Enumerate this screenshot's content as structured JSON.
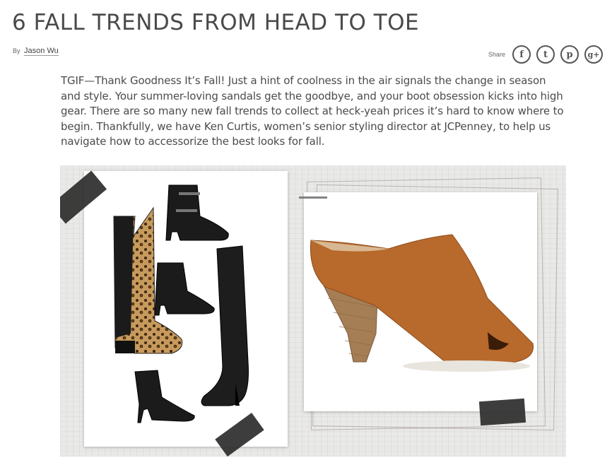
{
  "article": {
    "title": "6 FALL TRENDS FROM HEAD TO TOE",
    "byline_prefix": "By",
    "author": "Jason Wu",
    "intro": "TGIF—Thank Goodness It’s Fall! Just a hint of coolness in the air signals the change in season and style. Your summer-loving sandals get the goodbye, and your boot obsession kicks into high gear. There are so many new fall trends to collect at heck-yeah prices it’s hard to know where to begin. Thankfully, we have Ken Curtis, women’s senior styling director at JCPenney, to help us navigate how to accessorize the best looks for fall."
  },
  "share": {
    "label": "Share",
    "icons": [
      {
        "name": "facebook-icon",
        "glyph": "f"
      },
      {
        "name": "twitter-icon",
        "glyph": "t"
      },
      {
        "name": "pinterest-icon",
        "glyph": "p"
      },
      {
        "name": "googleplus-icon",
        "glyph": "g+"
      }
    ]
  },
  "colors": {
    "boot_black": "#1b1b1b",
    "leopard": "#b98a4e",
    "mule_tan": "#b8692c",
    "heel_wood": "#a57e55"
  }
}
